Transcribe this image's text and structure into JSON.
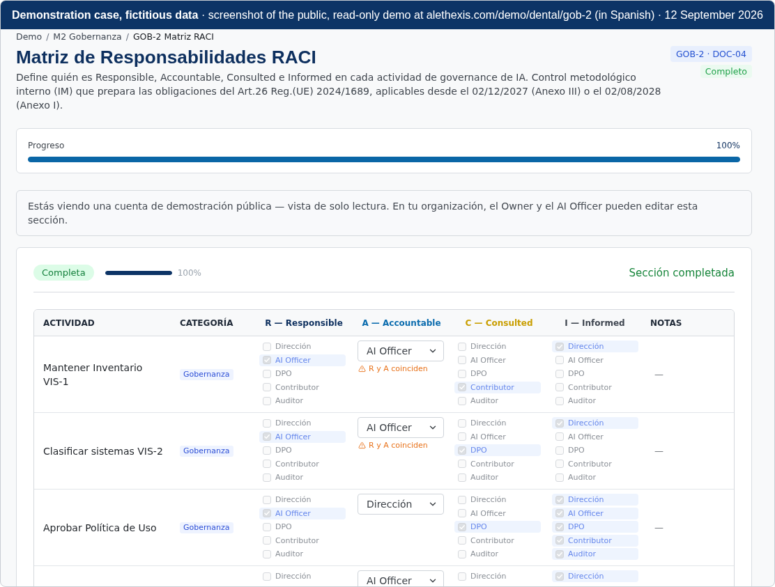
{
  "banner": {
    "text": "**Demonstration case, fictitious data** · screenshot of the public, read-only demo at alethexis.com/demo/dental/gob-2 (in Spanish) · 12 September 2026"
  },
  "breadcrumbs": [
    {
      "kind": "link",
      "label": "Demo"
    },
    {
      "kind": "separator",
      "label": "/"
    },
    {
      "kind": "link",
      "label": "M2 Gobernanza"
    },
    {
      "kind": "separator",
      "label": "/"
    },
    {
      "kind": "current",
      "label": "GOB-2 Matriz RACI"
    }
  ],
  "header": {
    "title": "Matriz de Responsabilidades RACI",
    "description": "Define quién es Responsible, Accountable, Consulted e Informed en cada actividad de governance de IA. Control metodológico interno (IM) que prepara las obligaciones del Art.26 Reg.(UE) 2024/1689, aplicables desde el 02/12/2027 (Anexo III) o el 02/08/2028 (Anexo I).",
    "badges": [
      {
        "kind": "code",
        "label": "GOB-2 · DOC-04"
      },
      {
        "kind": "status",
        "label": "Completo"
      }
    ]
  },
  "progress": {
    "label": "Progreso",
    "reading": "100%",
    "level": 1
  },
  "notice": {
    "text": "Estás viendo una cuenta de demostración pública — vista de solo lectura. En tu organización, el Owner y el AI Officer pueden editar esta sección."
  },
  "section": {
    "status": "Completa",
    "level": 1,
    "reading": "100%",
    "message": "Sección completada"
  },
  "table": {
    "columns": [
      {
        "kind": "text",
        "label": "ACTIVIDAD",
        "color": "#1f2937"
      },
      {
        "kind": "text",
        "label": "CATEGORÍA",
        "color": "#1f2937"
      },
      {
        "kind": "role",
        "label": "R — Responsible",
        "color": "#0d2f5e"
      },
      {
        "kind": "role",
        "label": "A — Accountable",
        "color": "#0b6cae"
      },
      {
        "kind": "role",
        "label": "C — Consulted",
        "color": "#c99e00"
      },
      {
        "kind": "role",
        "label": "I — Informed",
        "color": "#3f4650"
      },
      {
        "kind": "text",
        "label": "NOTAS",
        "color": "#1f2937"
      }
    ],
    "rows": [
      {
        "activity": "Mantener Inventario VIS-1",
        "category": "Gobernanza",
        "responsible": [
          {
            "label": "Dirección",
            "checked": false
          },
          {
            "label": "AI Officer",
            "checked": true
          },
          {
            "label": "DPO",
            "checked": false
          },
          {
            "label": "Contributor",
            "checked": false
          },
          {
            "label": "Auditor",
            "checked": false
          }
        ],
        "accountable": {
          "value": "AI Officer",
          "warning": "R y A coinciden"
        },
        "consulted": [
          {
            "label": "Dirección",
            "checked": false
          },
          {
            "label": "AI Officer",
            "checked": false
          },
          {
            "label": "DPO",
            "checked": false
          },
          {
            "label": "Contributor",
            "checked": true
          },
          {
            "label": "Auditor",
            "checked": false
          }
        ],
        "informed": [
          {
            "label": "Dirección",
            "checked": true
          },
          {
            "label": "AI Officer",
            "checked": false
          },
          {
            "label": "DPO",
            "checked": false
          },
          {
            "label": "Contributor",
            "checked": false
          },
          {
            "label": "Auditor",
            "checked": false
          }
        ],
        "notes": "—"
      },
      {
        "activity": "Clasificar sistemas VIS-2",
        "category": "Gobernanza",
        "responsible": [
          {
            "label": "Dirección",
            "checked": false
          },
          {
            "label": "AI Officer",
            "checked": true
          },
          {
            "label": "DPO",
            "checked": false
          },
          {
            "label": "Contributor",
            "checked": false
          },
          {
            "label": "Auditor",
            "checked": false
          }
        ],
        "accountable": {
          "value": "AI Officer",
          "warning": "R y A coinciden"
        },
        "consulted": [
          {
            "label": "Dirección",
            "checked": false
          },
          {
            "label": "AI Officer",
            "checked": false
          },
          {
            "label": "DPO",
            "checked": true
          },
          {
            "label": "Contributor",
            "checked": false
          },
          {
            "label": "Auditor",
            "checked": false
          }
        ],
        "informed": [
          {
            "label": "Dirección",
            "checked": true
          },
          {
            "label": "AI Officer",
            "checked": false
          },
          {
            "label": "DPO",
            "checked": false
          },
          {
            "label": "Contributor",
            "checked": false
          },
          {
            "label": "Auditor",
            "checked": false
          }
        ],
        "notes": "—"
      },
      {
        "activity": "Aprobar Política de Uso",
        "category": "Gobernanza",
        "responsible": [
          {
            "label": "Dirección",
            "checked": false
          },
          {
            "label": "AI Officer",
            "checked": true
          },
          {
            "label": "DPO",
            "checked": false
          },
          {
            "label": "Contributor",
            "checked": false
          },
          {
            "label": "Auditor",
            "checked": false
          }
        ],
        "accountable": {
          "value": "Dirección"
        },
        "consulted": [
          {
            "label": "Dirección",
            "checked": false
          },
          {
            "label": "AI Officer",
            "checked": false
          },
          {
            "label": "DPO",
            "checked": true
          },
          {
            "label": "Contributor",
            "checked": false
          },
          {
            "label": "Auditor",
            "checked": false
          }
        ],
        "informed": [
          {
            "label": "Dirección",
            "checked": true
          },
          {
            "label": "AI Officer",
            "checked": true
          },
          {
            "label": "DPO",
            "checked": true
          },
          {
            "label": "Contributor",
            "checked": true
          },
          {
            "label": "Auditor",
            "checked": true
          }
        ],
        "notes": "—"
      },
      {
        "responsible": [
          {
            "label": "Dirección",
            "checked": false
          }
        ],
        "accountable": {
          "value": "AI Officer"
        },
        "consulted": [
          {
            "label": "Dirección",
            "checked": false
          }
        ],
        "informed": [
          {
            "label": "Dirección",
            "checked": true
          }
        ]
      }
    ]
  }
}
